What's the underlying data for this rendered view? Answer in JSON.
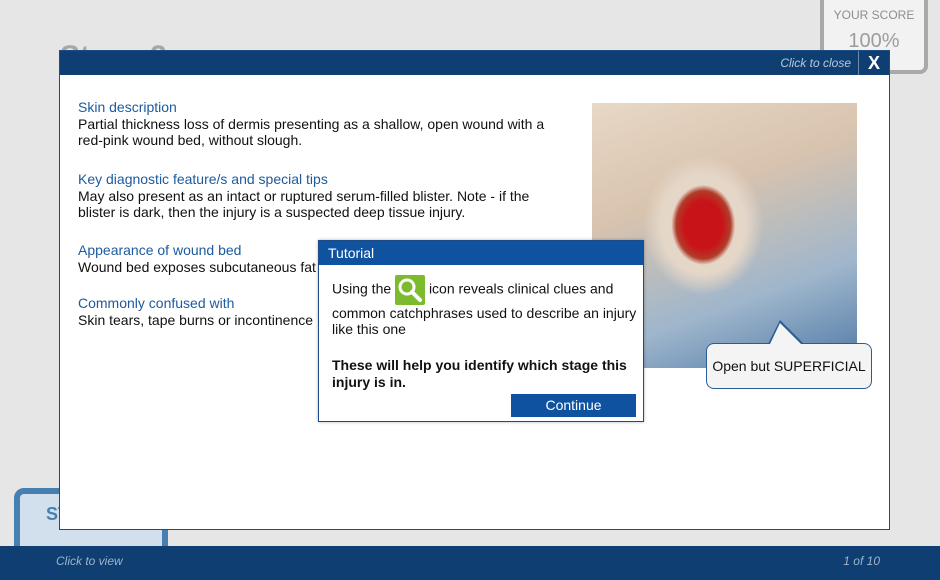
{
  "background": {
    "title": "Stage 2 ...",
    "score_label": "YOUR SCORE",
    "score_value": "100%",
    "badge_text": "ST",
    "footer_hint": "Click to view",
    "pager": "1 of 10"
  },
  "modal": {
    "close_text": "Click to close",
    "close_icon": "X",
    "sections": [
      {
        "heading": "Skin description",
        "body": "Partial thickness loss of dermis presenting as a shallow, open wound with a red-pink wound bed, without slough."
      },
      {
        "heading": "Key diagnostic feature/s and special tips",
        "body": "May also present as an intact or ruptured serum-filled blister. Note - if the blister is dark, then the injury is a suspected deep tissue injury."
      },
      {
        "heading": "Appearance of wound bed",
        "body": "Wound bed exposes subcutaneous fat"
      },
      {
        "heading": "Commonly confused with",
        "body": "Skin tears, tape burns or incontinence"
      }
    ],
    "callout": "Open but SUPERFICIAL"
  },
  "tutorial": {
    "title": "Tutorial",
    "text_before_icon": "Using the",
    "icon": "magnifier-icon",
    "text_after_icon": "icon reveals clinical clues and common catchphrases used to describe an injury like this one",
    "bold_text": "These will help you identify which stage this injury is in.",
    "continue_label": "Continue"
  },
  "colors": {
    "header_blue": "#0f3f72",
    "accent_blue": "#0f52a0",
    "heading_blue": "#1d5a9e",
    "icon_green": "#7dbb2e"
  }
}
